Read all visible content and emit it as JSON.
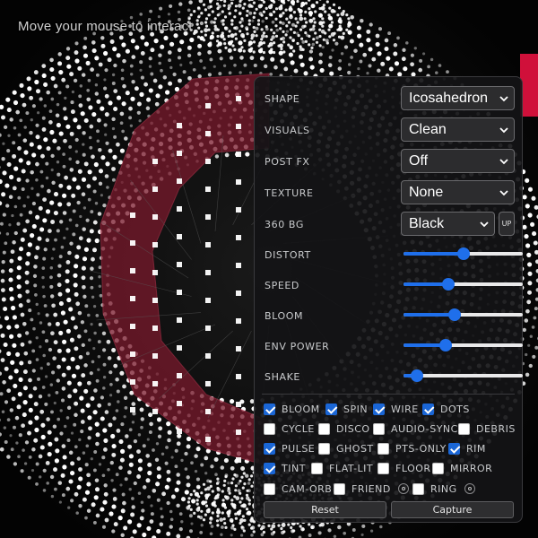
{
  "hint_text": "Move your mouse to interact",
  "colors": {
    "accent": "#1f6feb",
    "checkbox_on": "#1a66d6",
    "panel_bg": "#141416",
    "glow_red": "#8a1f33"
  },
  "controls": {
    "selects": [
      {
        "label": "SHAPE",
        "value": "Icosahedron"
      },
      {
        "label": "VISUALS",
        "value": "Clean"
      },
      {
        "label": "POST FX",
        "value": "Off"
      },
      {
        "label": "TEXTURE",
        "value": "None"
      },
      {
        "label": "360 BG",
        "value": "Black",
        "extra_button": "UP"
      }
    ],
    "sliders": [
      {
        "label": "DISTORT",
        "value": 0.5
      },
      {
        "label": "SPEED",
        "value": 0.36
      },
      {
        "label": "BLOOM",
        "value": 0.42
      },
      {
        "label": "ENV POWER",
        "value": 0.34
      },
      {
        "label": "SHAKE",
        "value": 0.07
      }
    ],
    "checkboxes": [
      {
        "label": "BLOOM",
        "checked": true
      },
      {
        "label": "SPIN",
        "checked": true
      },
      {
        "label": "WIRE",
        "checked": true
      },
      {
        "label": "DOTS",
        "checked": true
      },
      {
        "label": "CYCLE",
        "checked": false
      },
      {
        "label": "DISCO",
        "checked": false
      },
      {
        "label": "AUDIO-SYNC",
        "checked": false
      },
      {
        "label": "DEBRIS",
        "checked": false
      },
      {
        "label": "PULSE",
        "checked": true
      },
      {
        "label": "GHOST",
        "checked": false
      },
      {
        "label": "PTS-ONLY",
        "checked": false
      },
      {
        "label": "RIM",
        "checked": true
      },
      {
        "label": "TINT",
        "checked": true
      },
      {
        "label": "FLAT-LIT",
        "checked": false
      },
      {
        "label": "FLOOR",
        "checked": false
      },
      {
        "label": "MIRROR",
        "checked": false
      },
      {
        "label": "CAM-ORB",
        "checked": false
      },
      {
        "label": "FRIEND",
        "checked": false,
        "settings_icon": "gear-icon"
      },
      {
        "label": "RING",
        "checked": false,
        "settings_icon": "gear-icon"
      }
    ],
    "buttons": {
      "reset": "Reset",
      "capture": "Capture"
    }
  }
}
